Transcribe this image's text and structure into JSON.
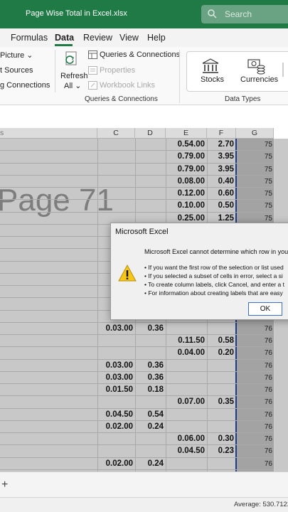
{
  "titlebar": {
    "file_name": "Page Wise Total in Excel.xlsx",
    "search_placeholder": "Search"
  },
  "tabs": [
    {
      "label": "Formulas",
      "active": false
    },
    {
      "label": "Data",
      "active": true
    },
    {
      "label": "Review",
      "active": false
    },
    {
      "label": "View",
      "active": false
    },
    {
      "label": "Help",
      "active": false
    }
  ],
  "ribbon": {
    "left_items": [
      "Picture",
      "t Sources",
      "g Connections"
    ],
    "refresh_label": "Refresh",
    "refresh_all_label": "All",
    "queries": {
      "queries_connections": "Queries & Connections",
      "properties": "Properties",
      "workbook_links": "Workbook Links",
      "group_label": "Queries & Connections"
    },
    "data_types": {
      "stocks": "Stocks",
      "currencies": "Currencies",
      "group_label": "Data Types"
    }
  },
  "columns": [
    "C",
    "D",
    "E",
    "F",
    "G"
  ],
  "watermark": "Page 71",
  "rows": [
    {
      "c": "",
      "d": "",
      "e": "0.54.00",
      "f": "2.70",
      "g": "75"
    },
    {
      "c": "",
      "d": "",
      "e": "0.79.00",
      "f": "3.95",
      "g": "75"
    },
    {
      "c": "",
      "d": "",
      "e": "0.79.00",
      "f": "3.95",
      "g": "75"
    },
    {
      "c": "",
      "d": "",
      "e": "0.08.00",
      "f": "0.40",
      "g": "75"
    },
    {
      "c": "",
      "d": "",
      "e": "0.12.00",
      "f": "0.60",
      "g": "75"
    },
    {
      "c": "",
      "d": "",
      "e": "0.10.00",
      "f": "0.50",
      "g": "75"
    },
    {
      "c": "",
      "d": "",
      "e": "0.25.00",
      "f": "1.25",
      "g": "75"
    },
    {
      "c": "",
      "d": "",
      "e": "",
      "f": "",
      "g": ""
    },
    {
      "c": "",
      "d": "",
      "e": "",
      "f": "",
      "g": ""
    },
    {
      "c": "",
      "d": "",
      "e": "",
      "f": "",
      "g": ""
    },
    {
      "c": "0",
      "d": "",
      "e": "",
      "f": "",
      "g": ""
    },
    {
      "c": "0",
      "d": "",
      "e": "",
      "f": "",
      "g": ""
    },
    {
      "c": "",
      "d": "",
      "e": "",
      "f": "",
      "g": ""
    },
    {
      "c": "",
      "d": "",
      "e": "",
      "f": "",
      "g": ""
    },
    {
      "c": "",
      "d": "",
      "e": "",
      "f": "",
      "g": ""
    },
    {
      "c": "0.03.00",
      "d": "0.36",
      "e": "",
      "f": "",
      "g": "76"
    },
    {
      "c": "",
      "d": "",
      "e": "0.11.50",
      "f": "0.58",
      "g": "76"
    },
    {
      "c": "",
      "d": "",
      "e": "0.04.00",
      "f": "0.20",
      "g": "76"
    },
    {
      "c": "0.03.00",
      "d": "0.36",
      "e": "",
      "f": "",
      "g": "76"
    },
    {
      "c": "0.03.00",
      "d": "0.36",
      "e": "",
      "f": "",
      "g": "76"
    },
    {
      "c": "0.01.50",
      "d": "0.18",
      "e": "",
      "f": "",
      "g": "76"
    },
    {
      "c": "",
      "d": "",
      "e": "0.07.00",
      "f": "0.35",
      "g": "76"
    },
    {
      "c": "0.04.50",
      "d": "0.54",
      "e": "",
      "f": "",
      "g": "76"
    },
    {
      "c": "0.02.00",
      "d": "0.24",
      "e": "",
      "f": "",
      "g": "76"
    },
    {
      "c": "",
      "d": "",
      "e": "0.06.00",
      "f": "0.30",
      "g": "76"
    },
    {
      "c": "",
      "d": "",
      "e": "0.04.50",
      "f": "0.23",
      "g": "76"
    },
    {
      "c": "0.02.00",
      "d": "0.24",
      "e": "",
      "f": "",
      "g": "76"
    }
  ],
  "dialog": {
    "title": "Microsoft Excel",
    "message": "Microsoft Excel cannot determine which row in your",
    "bullets": [
      "• If you want the first row of the selection or list used",
      "• If you selected a subset of cells in error, select a si",
      "• To create column labels, click Cancel, and enter a t",
      "• For information about creating labels that are easy"
    ],
    "ok_label": "OK"
  },
  "sheetbar": {
    "add_label": "+"
  },
  "statusbar": {
    "average": "Average: 530.71223"
  },
  "colors": {
    "title_green": "#1f7a46",
    "selection_border": "#1d3a8a",
    "warning_yellow": "#f5c518"
  }
}
